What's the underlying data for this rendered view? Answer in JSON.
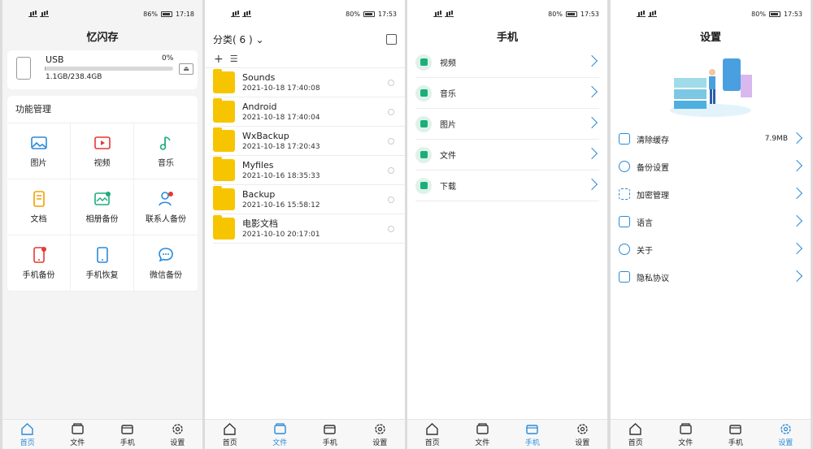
{
  "screens": [
    {
      "status": {
        "time": "17:18",
        "battery": "86%"
      },
      "title": "忆闪存"
    },
    {
      "status": {
        "time": "17:53",
        "battery": "80%"
      }
    },
    {
      "status": {
        "time": "17:53",
        "battery": "80%"
      },
      "title": "手机"
    },
    {
      "status": {
        "time": "17:53",
        "battery": "80%"
      },
      "title": "设置"
    }
  ],
  "usb": {
    "name": "USB",
    "percent": "0%",
    "size": "1.1GB/238.4GB",
    "fill": 0.005
  },
  "functions": {
    "heading": "功能管理",
    "items": [
      "图片",
      "视频",
      "音乐",
      "文档",
      "相册备份",
      "联系人备份",
      "手机备份",
      "手机恢复",
      "微信备份"
    ]
  },
  "categories": {
    "heading": "分类( 6 )",
    "files": [
      {
        "name": "Sounds",
        "date": "2021-10-18 17:40:08"
      },
      {
        "name": "Android",
        "date": "2021-10-18 17:40:04"
      },
      {
        "name": "WxBackup",
        "date": "2021-10-18 17:20:43"
      },
      {
        "name": "Myfiles",
        "date": "2021-10-16 18:35:33"
      },
      {
        "name": "Backup",
        "date": "2021-10-16 15:58:12"
      },
      {
        "name": "电影文档",
        "date": "2021-10-10 20:17:01"
      }
    ]
  },
  "phone": {
    "items": [
      "视频",
      "音乐",
      "图片",
      "文件",
      "下载"
    ]
  },
  "settings": {
    "items": [
      {
        "label": "清除缓存",
        "value": "7.9MB"
      },
      {
        "label": "备份设置",
        "value": ""
      },
      {
        "label": "加密管理",
        "value": ""
      },
      {
        "label": "语言",
        "value": ""
      },
      {
        "label": "关于",
        "value": ""
      },
      {
        "label": "隐私协议",
        "value": ""
      }
    ]
  },
  "tabs": [
    "首页",
    "文件",
    "手机",
    "设置"
  ],
  "colors": {
    "accent": "#2a8ad8",
    "folder": "#f7c500",
    "green": "#1cae7a",
    "red": "#e53935"
  }
}
